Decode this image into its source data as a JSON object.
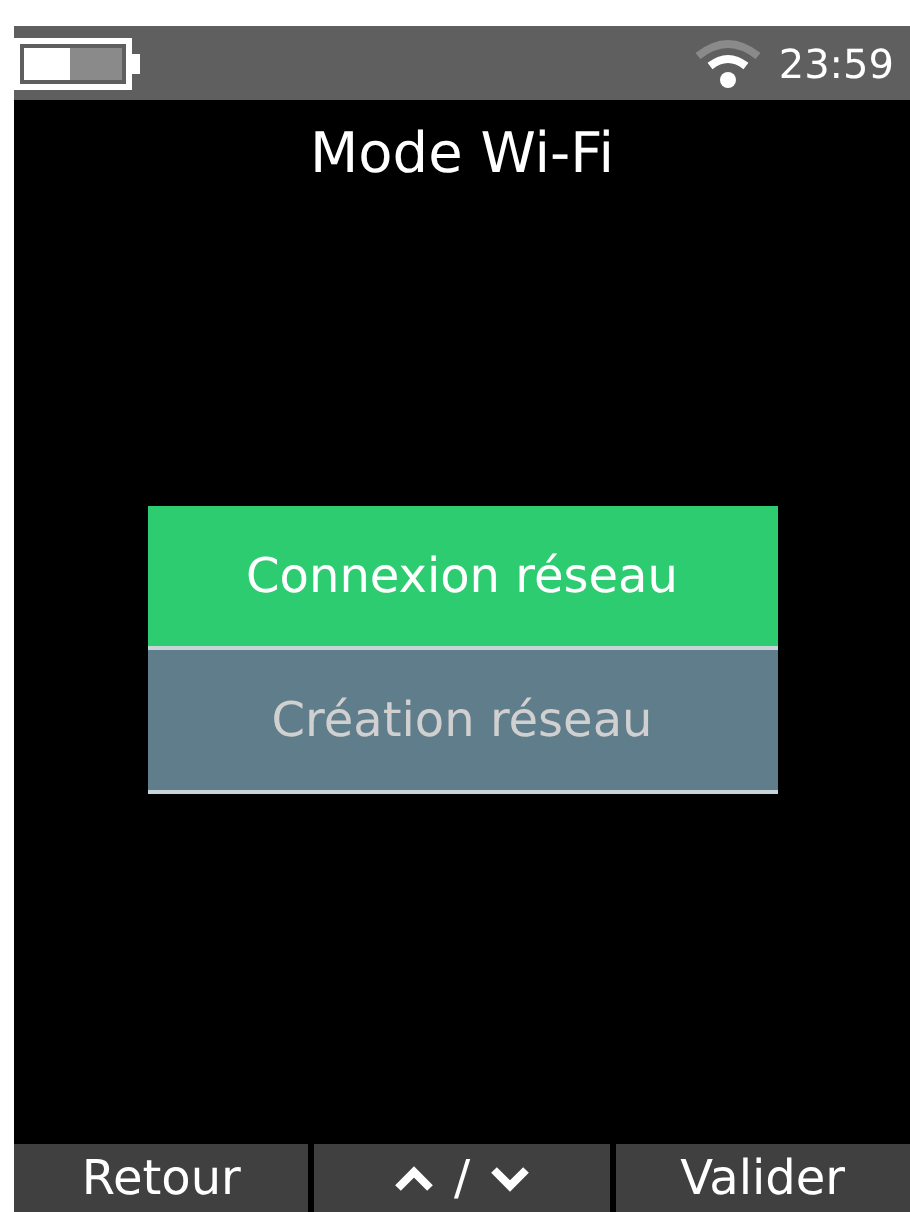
{
  "status_bar": {
    "time": "23:59"
  },
  "title": "Mode Wi-Fi",
  "menu": [
    {
      "label": "Connexion réseau",
      "selected": true
    },
    {
      "label": "Création réseau",
      "selected": false
    }
  ],
  "footer": [
    {
      "kind": "label",
      "label": "Retour"
    },
    {
      "kind": "nav",
      "label": "/"
    },
    {
      "kind": "label",
      "label": "Valider"
    }
  ]
}
